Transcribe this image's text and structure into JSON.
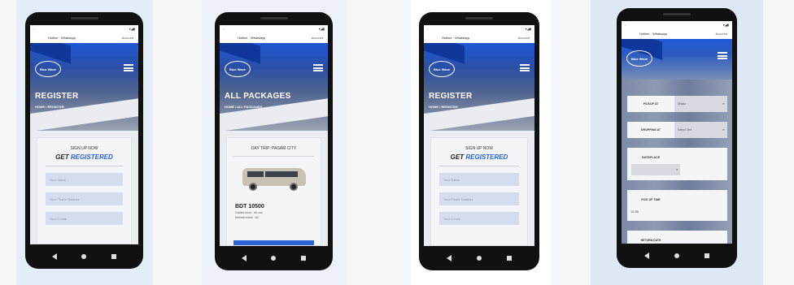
{
  "phones": [
    {
      "topbar": {
        "left": "Hotline · Whatsapp",
        "account": "Account"
      },
      "hero_title": "REGISTER",
      "breadcrumb": "HOME / REGISTER",
      "signup_heading": "SIGN UP NOW",
      "get_label": "GET",
      "registered_label": "REGISTERED",
      "fields": [
        "Your Name",
        "Your Phone Number",
        "Your E-mail"
      ]
    },
    {
      "topbar": {
        "left": "Hotline · Whatsapp",
        "account": "Account"
      },
      "hero_title": "ALL PACKAGES",
      "breadcrumb": "HOME / ALL PACKAGES",
      "package": {
        "title": "DAY TRIP: PASAM CITY",
        "price": "BDT 10500",
        "features": [
          "Guided tours · Air-con",
          "Refreshments · AC"
        ]
      }
    },
    {
      "topbar": {
        "left": "Hotline · Whatsapp",
        "account": "Account"
      },
      "hero_title": "REGISTER",
      "breadcrumb": "HOME / REGISTER",
      "signup_heading": "SIGN UP NOW",
      "get_label": "GET",
      "registered_label": "REGISTERED",
      "fields": [
        "Your Name",
        "Your Phone Number",
        "Your E-mail"
      ]
    },
    {
      "topbar": {
        "left": "Hotline · Whatsapp",
        "account": "Account"
      },
      "form": {
        "pickup_label": "PICKUP AT",
        "pickup_value": "Dhaka",
        "dropping_label": "DROPPING AT",
        "dropping_value": "Select One",
        "date_label": "DATE/PLACE",
        "time_label": "PICK UP TIME",
        "time_value": "12:30",
        "return_label": "RETURN DATE"
      }
    }
  ],
  "logo_text": "Blue Wave",
  "colors": {
    "accent": "#2a62d8",
    "hero_top": "#1f58d6",
    "field_bg": "#d4dced"
  }
}
